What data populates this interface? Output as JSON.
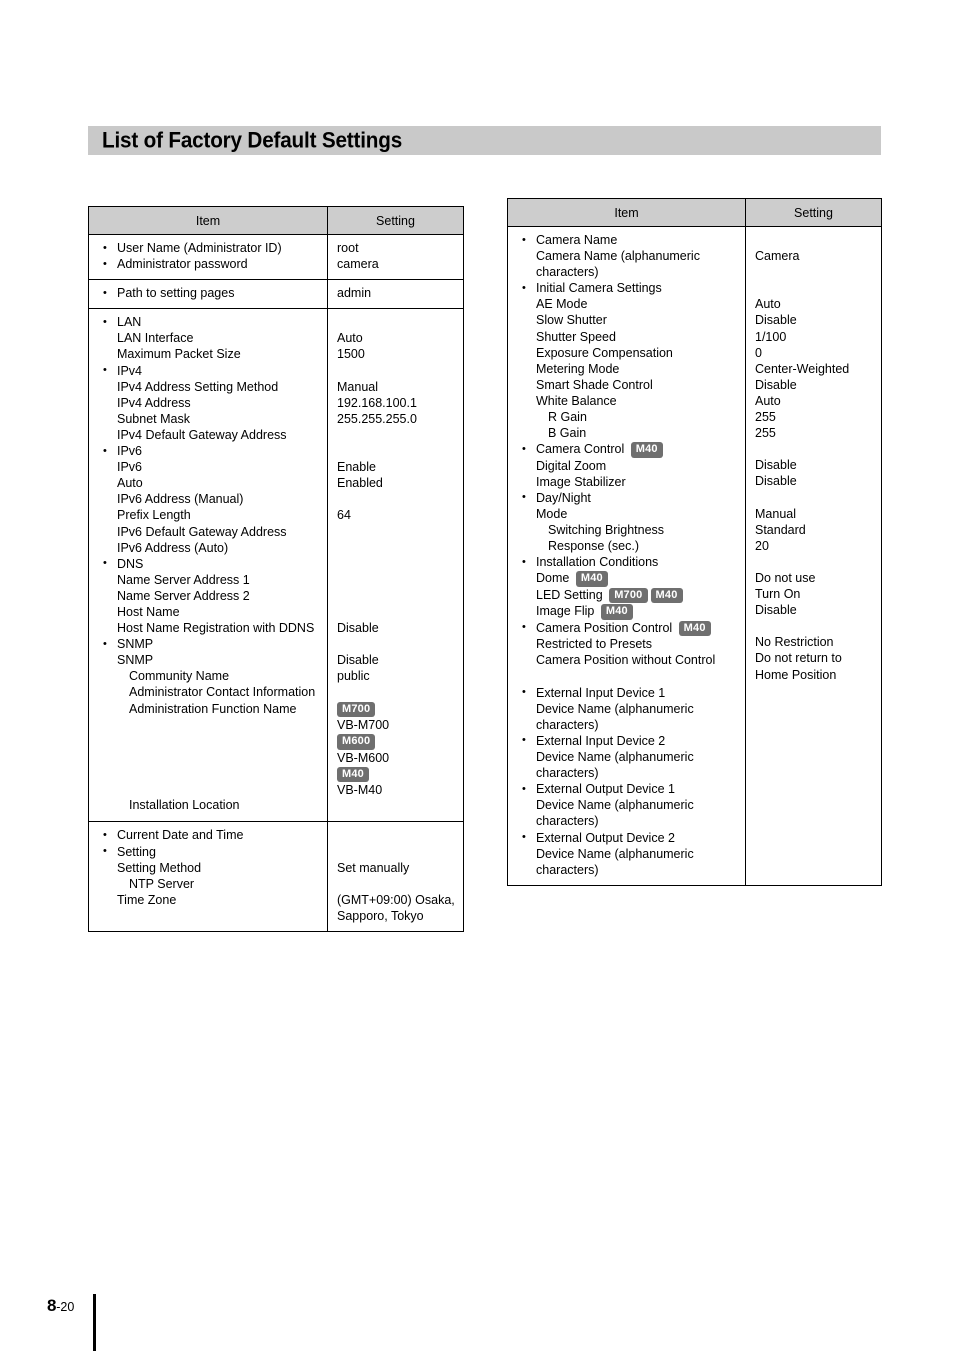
{
  "page": {
    "title": "List of Factory Default Settings",
    "footer_page_major": "8",
    "footer_page_minor": "-20"
  },
  "colors": {
    "banner_bg": "#c9c9c9",
    "table_header_bg": "#cdcdcd",
    "badge_bg": "#6f6f6f",
    "badge_text": "#ffffff",
    "border": "#000000"
  },
  "tables": {
    "left": {
      "headers": {
        "item": "Item",
        "setting": "Setting"
      },
      "rows": [
        {
          "item_lines": [
            {
              "text": "User Name (Administrator ID)",
              "style": "bullet"
            },
            {
              "text": "Administrator password",
              "style": "bullet"
            }
          ],
          "setting_lines": [
            {
              "text": "root"
            },
            {
              "text": "camera"
            }
          ]
        },
        {
          "item_lines": [
            {
              "text": "Path to setting pages",
              "style": "bullet"
            }
          ],
          "setting_lines": [
            {
              "text": "admin"
            }
          ]
        },
        {
          "item_lines": [
            {
              "text": "LAN",
              "style": "bullet"
            },
            {
              "text": "LAN Interface",
              "style": "lvl1"
            },
            {
              "text": "Maximum Packet Size",
              "style": "lvl1"
            },
            {
              "text": "IPv4",
              "style": "bullet"
            },
            {
              "text": "IPv4 Address Setting Method",
              "style": "lvl1"
            },
            {
              "text": "IPv4 Address",
              "style": "lvl1"
            },
            {
              "text": "Subnet Mask",
              "style": "lvl1"
            },
            {
              "text": "IPv4 Default Gateway Address",
              "style": "lvl1"
            },
            {
              "text": "IPv6",
              "style": "bullet"
            },
            {
              "text": "IPv6",
              "style": "lvl1"
            },
            {
              "text": "Auto",
              "style": "lvl1"
            },
            {
              "text": "IPv6 Address (Manual)",
              "style": "lvl1"
            },
            {
              "text": "Prefix Length",
              "style": "lvl1"
            },
            {
              "text": "IPv6 Default Gateway Address",
              "style": "lvl1"
            },
            {
              "text": "IPv6 Address (Auto)",
              "style": "lvl1"
            },
            {
              "text": "DNS",
              "style": "bullet"
            },
            {
              "text": "Name Server Address 1",
              "style": "lvl1"
            },
            {
              "text": "Name Server Address 2",
              "style": "lvl1"
            },
            {
              "text": "Host Name",
              "style": "lvl1"
            },
            {
              "text": "Host Name Registration with DDNS",
              "style": "lvl1"
            },
            {
              "text": "SNMP",
              "style": "bullet"
            },
            {
              "text": "SNMP",
              "style": "lvl1"
            },
            {
              "text": "Community Name",
              "style": "lvl2"
            },
            {
              "text": "Administrator Contact Information",
              "style": "lvl2"
            },
            {
              "text": "Administration Function Name",
              "style": "lvl2"
            },
            {
              "text": "",
              "style": "blank"
            },
            {
              "text": "",
              "style": "blank"
            },
            {
              "text": "",
              "style": "blank"
            },
            {
              "text": "",
              "style": "blank"
            },
            {
              "text": "",
              "style": "blank"
            },
            {
              "text": "Installation Location",
              "style": "lvl2"
            }
          ],
          "setting_lines": [
            {
              "text": ""
            },
            {
              "text": "Auto"
            },
            {
              "text": "1500"
            },
            {
              "text": ""
            },
            {
              "text": "Manual"
            },
            {
              "text": "192.168.100.1"
            },
            {
              "text": "255.255.255.0"
            },
            {
              "text": ""
            },
            {
              "text": ""
            },
            {
              "text": "Enable"
            },
            {
              "text": "Enabled"
            },
            {
              "text": ""
            },
            {
              "text": "64"
            },
            {
              "text": ""
            },
            {
              "text": ""
            },
            {
              "text": ""
            },
            {
              "text": ""
            },
            {
              "text": ""
            },
            {
              "text": ""
            },
            {
              "text": "Disable"
            },
            {
              "text": ""
            },
            {
              "text": "Disable"
            },
            {
              "text": "public"
            },
            {
              "text": ""
            },
            {
              "badges": [
                "M700"
              ]
            },
            {
              "text": "VB-M700"
            },
            {
              "badges": [
                "M600"
              ]
            },
            {
              "text": "VB-M600"
            },
            {
              "badges": [
                "M40"
              ]
            },
            {
              "text": "VB-M40"
            },
            {
              "text": ""
            }
          ]
        },
        {
          "item_lines": [
            {
              "text": "Current Date and Time",
              "style": "bullet"
            },
            {
              "text": "Setting",
              "style": "bullet"
            },
            {
              "text": "Setting Method",
              "style": "lvl1"
            },
            {
              "text": "NTP Server",
              "style": "lvl2"
            },
            {
              "text": "Time Zone",
              "style": "lvl1"
            }
          ],
          "setting_lines": [
            {
              "text": ""
            },
            {
              "text": ""
            },
            {
              "text": "Set manually"
            },
            {
              "text": ""
            },
            {
              "text": "(GMT+09:00) Osaka,"
            },
            {
              "text": "Sapporo, Tokyo"
            }
          ]
        }
      ]
    },
    "right": {
      "headers": {
        "item": "Item",
        "setting": "Setting"
      },
      "rows": [
        {
          "item_lines": [
            {
              "text": "Camera Name",
              "style": "bullet"
            },
            {
              "text": "Camera Name (alphanumeric",
              "style": "lvl1"
            },
            {
              "text": "characters)",
              "style": "lvl1"
            },
            {
              "text": "Initial Camera Settings",
              "style": "bullet"
            },
            {
              "text": "AE Mode",
              "style": "lvl1"
            },
            {
              "text": "Slow Shutter",
              "style": "lvl1"
            },
            {
              "text": "Shutter Speed",
              "style": "lvl1"
            },
            {
              "text": "Exposure Compensation",
              "style": "lvl1"
            },
            {
              "text": "Metering Mode",
              "style": "lvl1"
            },
            {
              "text": "Smart Shade Control",
              "style": "lvl1"
            },
            {
              "text": "White Balance",
              "style": "lvl1"
            },
            {
              "text": "R Gain",
              "style": "lvl2"
            },
            {
              "text": "B Gain",
              "style": "lvl2"
            },
            {
              "text": "Camera Control ",
              "style": "bullet",
              "badges": [
                "M40"
              ]
            },
            {
              "text": "Digital Zoom",
              "style": "lvl1"
            },
            {
              "text": "Image Stabilizer",
              "style": "lvl1"
            },
            {
              "text": "Day/Night",
              "style": "bullet"
            },
            {
              "text": "Mode",
              "style": "lvl1"
            },
            {
              "text": "Switching Brightness",
              "style": "lvl2"
            },
            {
              "text": "Response (sec.)",
              "style": "lvl2"
            },
            {
              "text": "Installation Conditions",
              "style": "bullet"
            },
            {
              "text": "Dome ",
              "style": "lvl1",
              "badges": [
                "M40"
              ]
            },
            {
              "text": "LED Setting ",
              "style": "lvl1",
              "badges": [
                "M700",
                "M40"
              ]
            },
            {
              "text": "Image Flip ",
              "style": "lvl1",
              "badges": [
                "M40"
              ]
            },
            {
              "text": "Camera Position Control ",
              "style": "bullet",
              "badges": [
                "M40"
              ]
            },
            {
              "text": "Restricted to Presets",
              "style": "lvl1"
            },
            {
              "text": "Camera Position without Control",
              "style": "lvl1"
            },
            {
              "text": "",
              "style": "blank"
            },
            {
              "text": "External Input Device 1",
              "style": "bullet"
            },
            {
              "text": "Device Name (alphanumeric",
              "style": "lvl1"
            },
            {
              "text": "characters)",
              "style": "lvl1"
            },
            {
              "text": "External Input Device 2",
              "style": "bullet"
            },
            {
              "text": "Device Name (alphanumeric",
              "style": "lvl1"
            },
            {
              "text": "characters)",
              "style": "lvl1"
            },
            {
              "text": "External Output Device 1",
              "style": "bullet"
            },
            {
              "text": "Device Name (alphanumeric",
              "style": "lvl1"
            },
            {
              "text": "characters)",
              "style": "lvl1"
            },
            {
              "text": "External Output Device 2",
              "style": "bullet"
            },
            {
              "text": "Device Name (alphanumeric",
              "style": "lvl1"
            },
            {
              "text": "characters)",
              "style": "lvl1"
            }
          ],
          "setting_lines": [
            {
              "text": ""
            },
            {
              "text": "Camera"
            },
            {
              "text": ""
            },
            {
              "text": ""
            },
            {
              "text": "Auto"
            },
            {
              "text": "Disable"
            },
            {
              "text": "1/100"
            },
            {
              "text": "0"
            },
            {
              "text": "Center-Weighted"
            },
            {
              "text": "Disable"
            },
            {
              "text": "Auto"
            },
            {
              "text": "255"
            },
            {
              "text": "255"
            },
            {
              "text": ""
            },
            {
              "text": "Disable"
            },
            {
              "text": "Disable"
            },
            {
              "text": ""
            },
            {
              "text": "Manual"
            },
            {
              "text": "Standard"
            },
            {
              "text": "20"
            },
            {
              "text": ""
            },
            {
              "text": "Do not use"
            },
            {
              "text": "Turn On"
            },
            {
              "text": "Disable"
            },
            {
              "text": ""
            },
            {
              "text": "No Restriction"
            },
            {
              "text": "Do not return to"
            },
            {
              "text": "Home Position"
            }
          ]
        }
      ]
    }
  }
}
